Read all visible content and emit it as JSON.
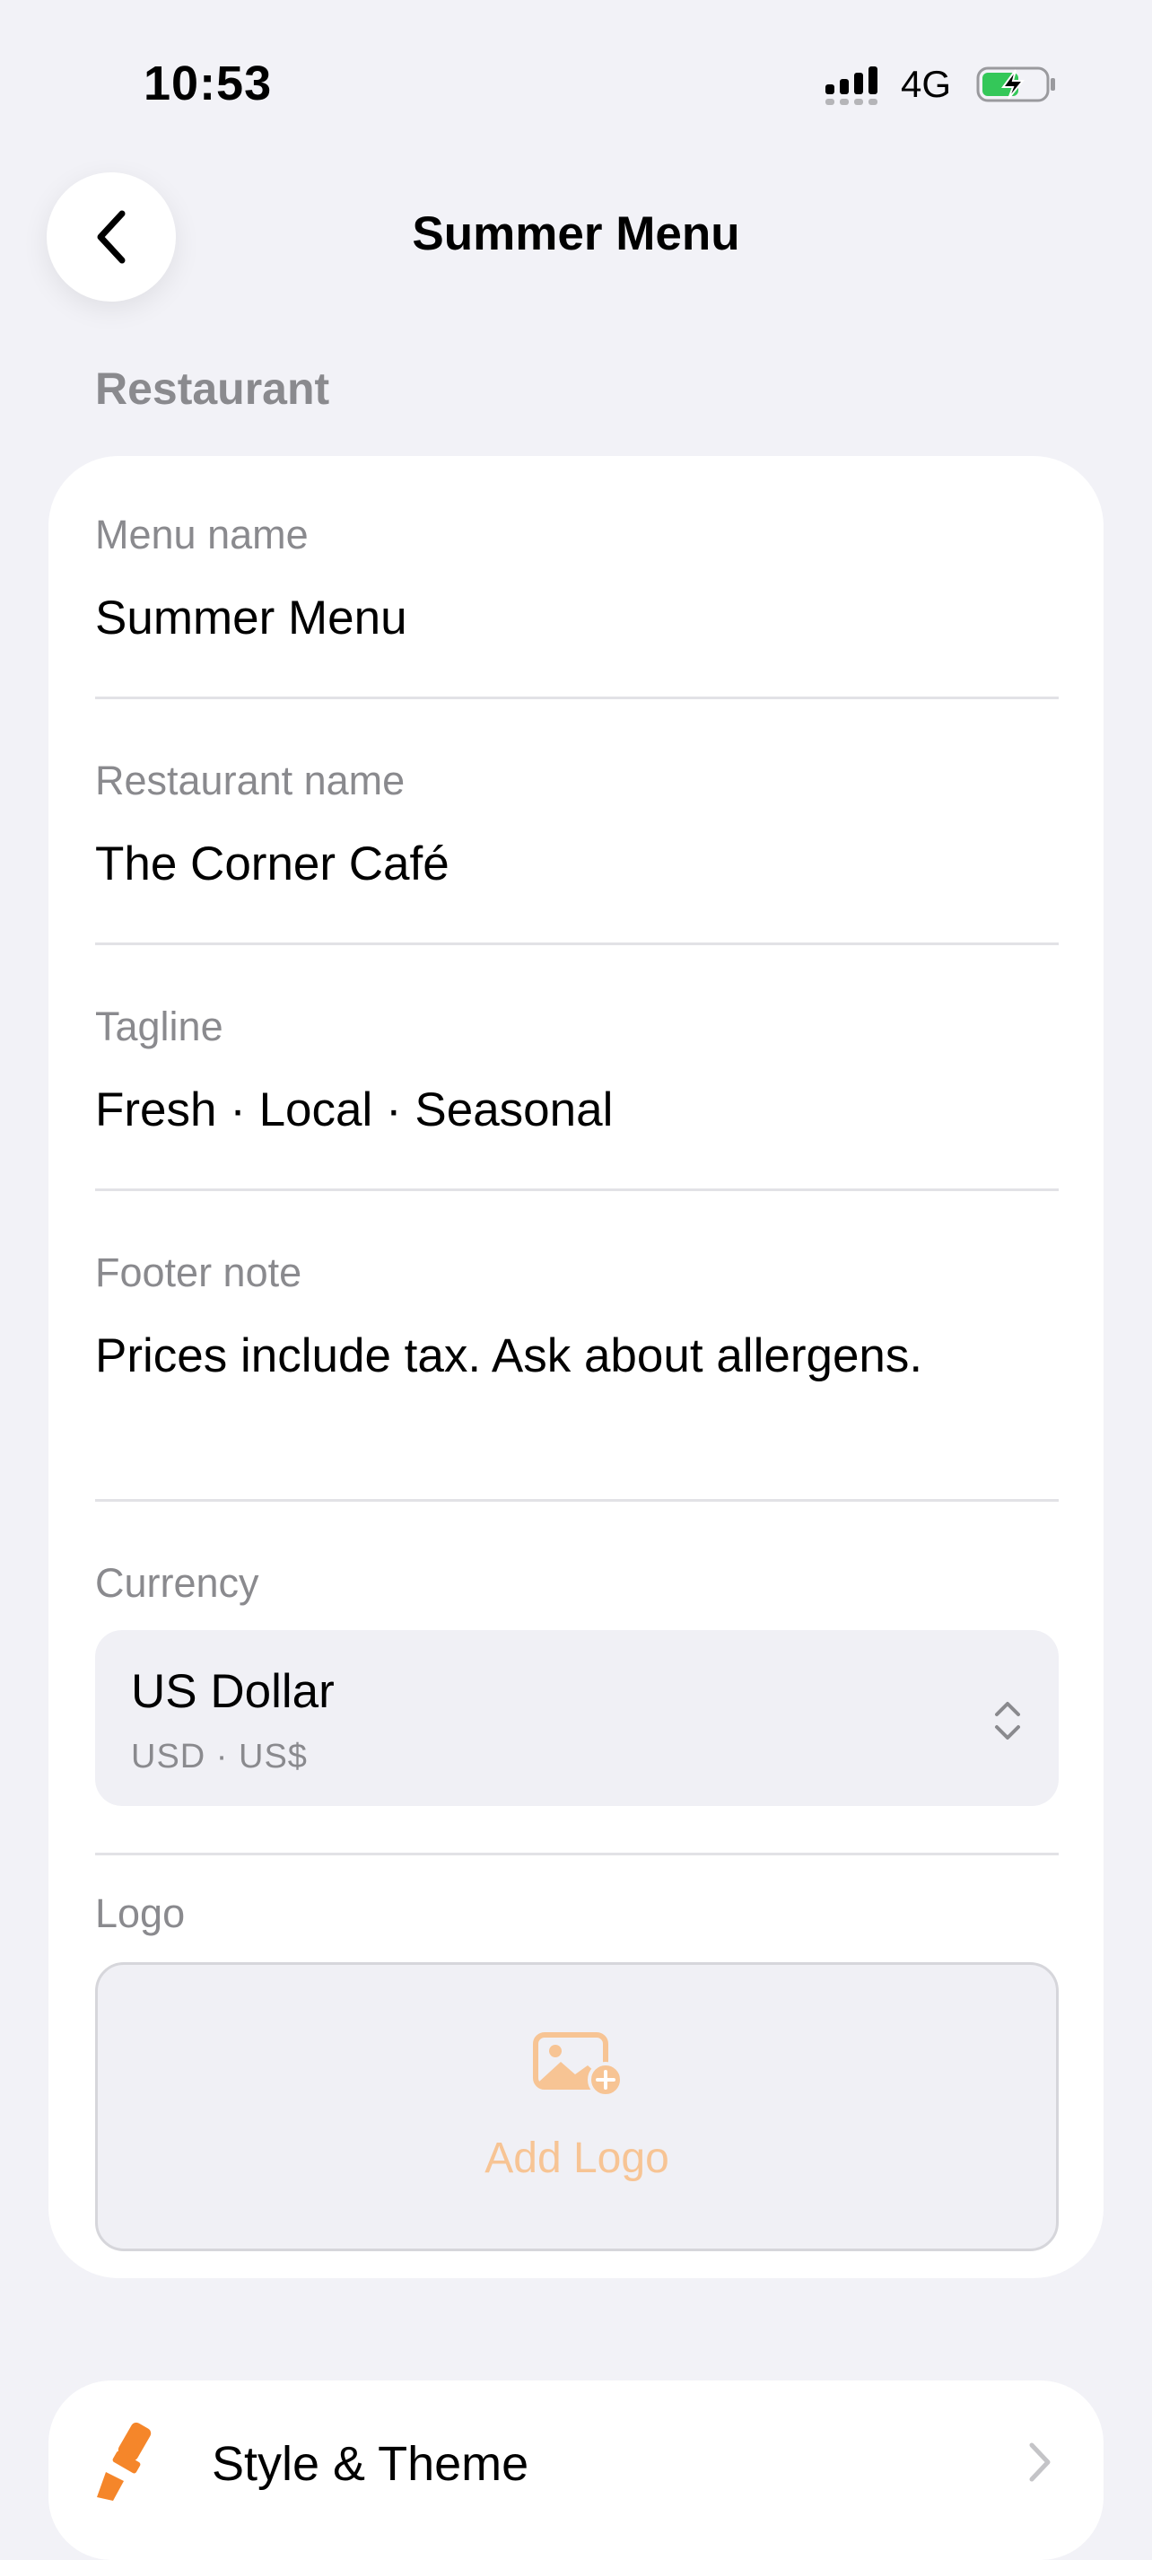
{
  "status_bar": {
    "time": "10:53",
    "network": "4G",
    "battery_color": "#34c759"
  },
  "nav": {
    "title": "Summer Menu",
    "back_icon": "chevron-left-icon"
  },
  "section": {
    "title": "Restaurant"
  },
  "fields": {
    "menu_name": {
      "label": "Menu name",
      "value": "Summer Menu"
    },
    "restaurant_name": {
      "label": "Restaurant name",
      "value": "The Corner Café"
    },
    "tagline": {
      "label": "Tagline",
      "value": "Fresh · Local · Seasonal"
    },
    "footer_note": {
      "label": "Footer note",
      "value": "Prices include tax. Ask about allergens."
    }
  },
  "currency": {
    "label": "Currency",
    "name": "US Dollar",
    "detail": "USD · US$",
    "icon": "chevron-up-down-icon"
  },
  "logo": {
    "label": "Logo",
    "button_label": "Add Logo",
    "icon": "add-photo-icon",
    "accent_color": "#f7c494"
  },
  "style_theme": {
    "label": "Style & Theme",
    "icon": "paintbrush-icon",
    "icon_color": "#f5862a"
  }
}
